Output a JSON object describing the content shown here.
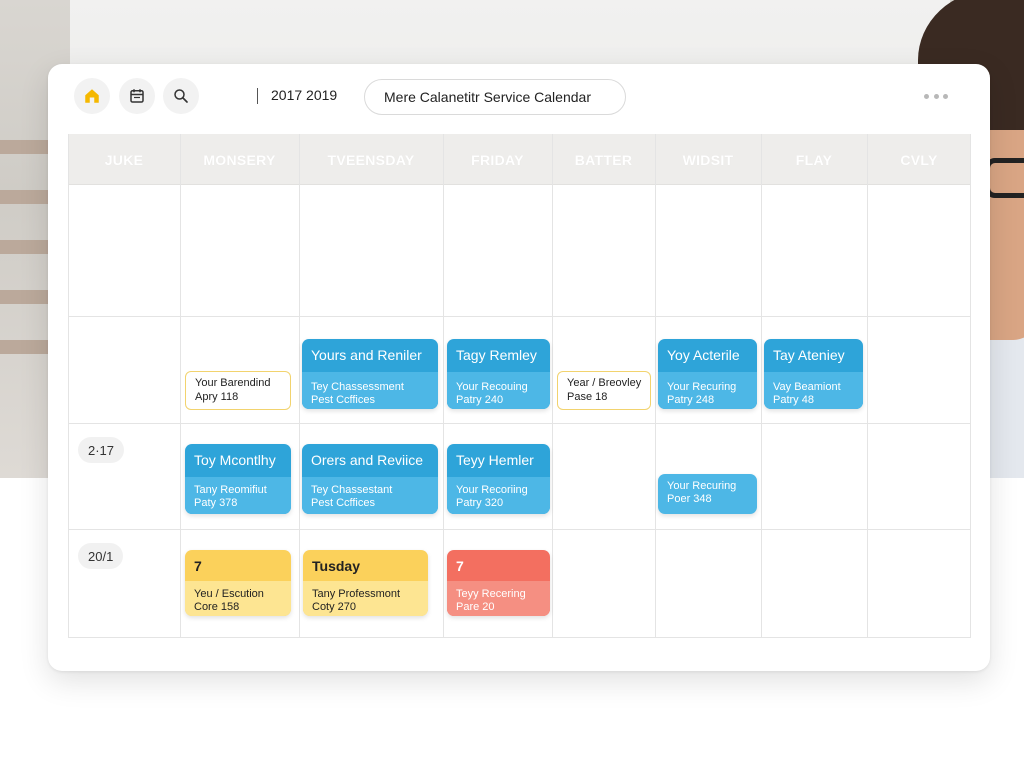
{
  "toolbar": {
    "range_label": "2017 2019",
    "calendar_title": "Mere Calanetitr Service Calendar"
  },
  "columns": [
    "JUKE",
    "MONSERY",
    "TVEENSDAY",
    "FRIDAY",
    "BATTER",
    "WIDSIT",
    "FLAY",
    "CVLY"
  ],
  "rows": [
    {
      "label": ""
    },
    {
      "label": ""
    },
    {
      "label": "2·17"
    },
    {
      "label": "20/1"
    }
  ],
  "events": [
    {
      "title": "",
      "line1": "Your Barendind",
      "line2": "Apry 118",
      "style": "outline"
    },
    {
      "title": "Yours and Reniler",
      "line1": "Tey Chassessment",
      "line2": "Pest Ccffices",
      "style": "blue"
    },
    {
      "title": "Tagy Remley",
      "line1": "Your Recouing",
      "line2": "Patry 240",
      "style": "blue"
    },
    {
      "title": "",
      "line1": "Year / Breovley",
      "line2": "Pase 18",
      "style": "outline"
    },
    {
      "title": "Yoy Acterile",
      "line1": "Your Recuring",
      "line2": "Patry 248",
      "style": "blue"
    },
    {
      "title": "Tay Ateniey",
      "line1": "Vay Beamiont",
      "line2": "Patry 48",
      "style": "blue"
    },
    {
      "title": "Toy Mcontlhy",
      "line1": "Tany Reomifiut",
      "line2": "Paty 378",
      "style": "blue"
    },
    {
      "title": "Orers and Reviice",
      "line1": "Tey Chassestant",
      "line2": "Pest Ccffices",
      "style": "blue"
    },
    {
      "title": "Teyy Hemler",
      "line1": "Your Recoriing",
      "line2": "Patry 320",
      "style": "blue"
    },
    {
      "title": "",
      "line1": "Your Recuring",
      "line2": "Poer 348",
      "style": "blue-light"
    },
    {
      "title": "7",
      "line1": "Yeu / Escution",
      "line2": "Core 158",
      "style": "yellow"
    },
    {
      "title": "Tusday",
      "line1": "Tany Professmont",
      "line2": "Coty 270",
      "style": "yellow"
    },
    {
      "title": "7",
      "line1": "Teyy Recering",
      "line2": "Pare 20",
      "style": "red"
    }
  ],
  "colors": {
    "accent_blue": "#2ea4d9",
    "accent_yellow": "#fbd15b",
    "accent_red": "#f36f60",
    "home_icon": "#f5b800"
  },
  "icons": [
    "home-icon",
    "calendar-icon",
    "search-icon",
    "more-icon"
  ]
}
